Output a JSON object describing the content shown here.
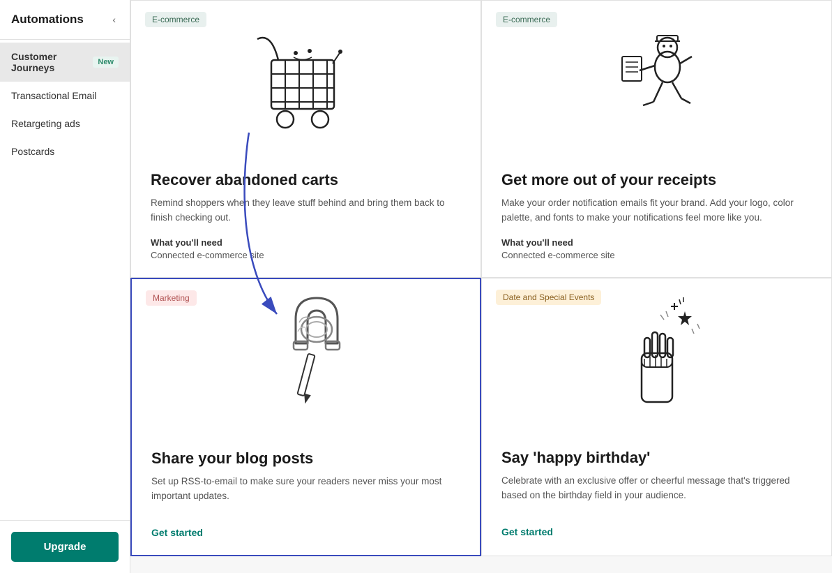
{
  "sidebar": {
    "title": "Automations",
    "collapse_icon": "‹",
    "items": [
      {
        "id": "customer-journeys",
        "label": "Customer Journeys",
        "badge": "New",
        "active": true
      },
      {
        "id": "transactional-email",
        "label": "Transactional Email",
        "badge": null,
        "active": false
      },
      {
        "id": "retargeting-ads",
        "label": "Retargeting ads",
        "badge": null,
        "active": false
      },
      {
        "id": "postcards",
        "label": "Postcards",
        "badge": null,
        "active": false
      }
    ],
    "upgrade_button_label": "Upgrade"
  },
  "cards": [
    {
      "id": "recover-abandoned-carts",
      "category": "E-commerce",
      "category_class": "badge-ecommerce",
      "title": "Recover abandoned carts",
      "description": "Remind shoppers when they leave stuff behind and bring them back to finish checking out.",
      "need_label": "What you'll need",
      "need_value": "Connected e-commerce site",
      "get_started": null,
      "highlighted": false,
      "illustration": "cart"
    },
    {
      "id": "get-more-receipts",
      "category": "E-commerce",
      "category_class": "badge-ecommerce",
      "title": "Get more out of your receipts",
      "description": "Make your order notification emails fit your brand. Add your logo, color palette, and fonts to make your notifications feel more like you.",
      "need_label": "What you'll need",
      "need_value": "Connected e-commerce site",
      "get_started": null,
      "highlighted": false,
      "illustration": "receipt"
    },
    {
      "id": "share-blog-posts",
      "category": "Marketing",
      "category_class": "badge-marketing",
      "title": "Share your blog posts",
      "description": "Set up RSS-to-email to make sure your readers never miss your most important updates.",
      "need_label": null,
      "need_value": null,
      "get_started": "Get started",
      "highlighted": true,
      "illustration": "blog"
    },
    {
      "id": "say-happy-birthday",
      "category": "Date and Special Events",
      "category_class": "badge-date-events",
      "title": "Say 'happy birthday'",
      "description": "Celebrate with an exclusive offer or cheerful message that's triggered based on the birthday field in your audience.",
      "need_label": null,
      "need_value": null,
      "get_started": "Get started",
      "highlighted": false,
      "illustration": "birthday"
    }
  ]
}
